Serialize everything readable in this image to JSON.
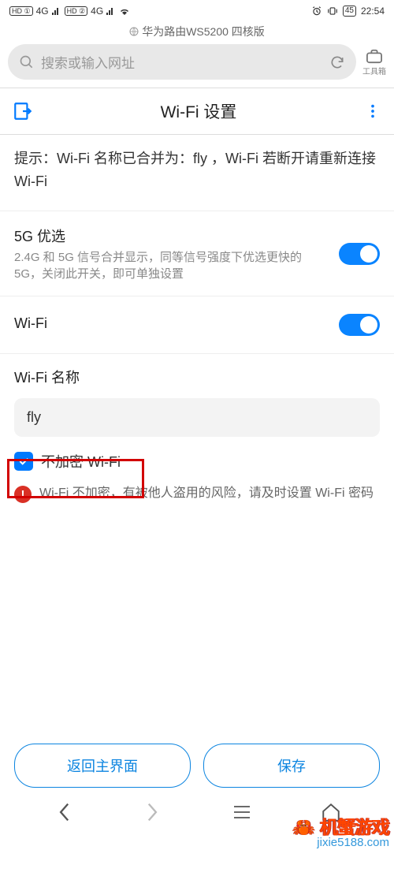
{
  "status": {
    "hd1": "HD ①",
    "hd2": "HD ②",
    "net1": "4G",
    "net2": "4G",
    "battery": "45",
    "time": "22:54"
  },
  "browser": {
    "tab_title": "华为路由WS5200 四核版",
    "search_placeholder": "搜索或输入网址",
    "toolbox_label": "工具箱"
  },
  "page": {
    "title": "Wi-Fi 设置",
    "tip": "提示：Wi-Fi 名称已合并为：fly ，Wi-Fi 若断开请重新连接 Wi-Fi"
  },
  "settings": {
    "priority_5g": {
      "title": "5G 优选",
      "desc": "2.4G 和 5G 信号合并显示，同等信号强度下优选更快的 5G，关闭此开关，即可单独设置"
    },
    "wifi": {
      "title": "Wi-Fi"
    },
    "name": {
      "label": "Wi-Fi 名称",
      "value": "fly"
    },
    "no_encrypt": {
      "label": "不加密 Wi-Fi"
    },
    "warning": "Wi-Fi 不加密，有被他人盗用的风险，请及时设置 Wi-Fi 密码"
  },
  "buttons": {
    "back_home": "返回主界面",
    "save": "保存"
  },
  "watermark": {
    "brand": "机蟹游戏",
    "url": "jixie5188.com"
  }
}
